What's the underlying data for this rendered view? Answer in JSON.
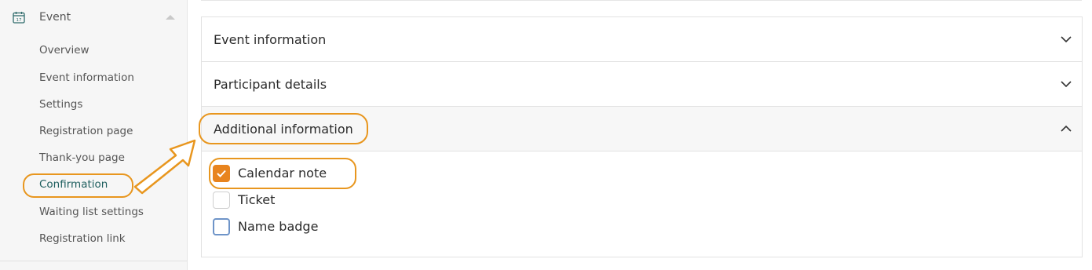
{
  "sidebar": {
    "section_label": "Event",
    "items": [
      {
        "label": "Overview"
      },
      {
        "label": "Event information"
      },
      {
        "label": "Settings"
      },
      {
        "label": "Registration page"
      },
      {
        "label": "Thank-you page"
      },
      {
        "label": "Confirmation",
        "active": true
      },
      {
        "label": "Waiting list settings"
      },
      {
        "label": "Registration link"
      }
    ]
  },
  "accordion": {
    "sections": [
      {
        "title": "Event information",
        "state": "collapsed"
      },
      {
        "title": "Participant details",
        "state": "collapsed"
      },
      {
        "title": "Additional information",
        "state": "expanded"
      }
    ],
    "options": [
      {
        "label": "Calendar note",
        "checked": true
      },
      {
        "label": "Ticket",
        "checked": false
      },
      {
        "label": "Name badge",
        "checked": false
      }
    ]
  },
  "icons": {
    "section": "calendar-icon",
    "collapse": "caret-up-icon",
    "expand": "chevron-down-icon",
    "collapse_section": "chevron-up-icon",
    "check": "checkmark-icon"
  },
  "colors": {
    "accent": "#e8841e",
    "annotation": "#e8961e",
    "active_nav": "#1f5f5f",
    "focus_border": "#6e94c8"
  }
}
